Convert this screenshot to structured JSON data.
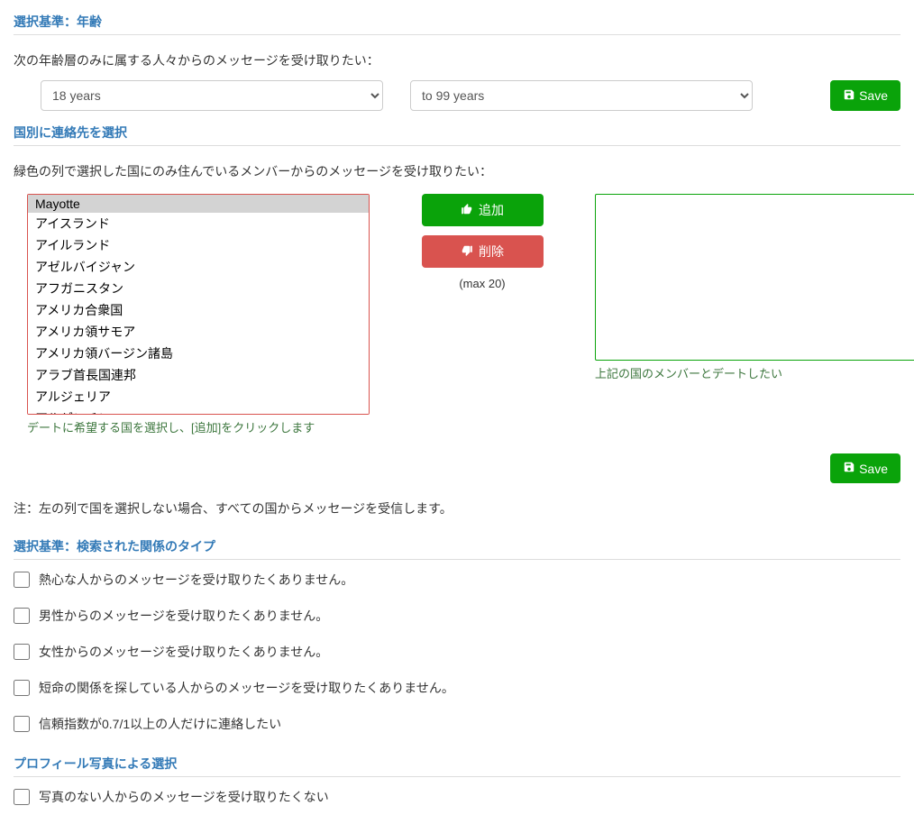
{
  "age": {
    "title": "選択基準：年齢",
    "desc": "次の年齢層のみに属する人々からのメッセージを受け取りたい：",
    "from": "18 years",
    "to": "to 99 years",
    "save": "Save"
  },
  "country": {
    "title": "国別に連絡先を選択",
    "desc": "緑色の列で選択した国にのみ住んでいるメンバーからのメッセージを受け取りたい：",
    "list": [
      "Mayotte",
      "アイスランド",
      "アイルランド",
      "アゼルバイジャン",
      "アフガニスタン",
      "アメリカ合衆国",
      "アメリカ領サモア",
      "アメリカ領バージン諸島",
      "アラブ首長国連邦",
      "アルジェリア",
      "アルゼンチン"
    ],
    "left_helper": "デートに希望する国を選択し、[追加]をクリックします",
    "right_helper": "上記の国のメンバーとデートしたい",
    "add": "追加",
    "remove": "削除",
    "max": "(max 20)",
    "save": "Save",
    "note": "注：左の列で国を選択しない場合、すべての国からメッセージを受信します。"
  },
  "relation": {
    "title": "選択基準：検索された関係のタイプ",
    "opts": [
      "熱心な人からのメッセージを受け取りたくありません。",
      "男性からのメッセージを受け取りたくありません。",
      "女性からのメッセージを受け取りたくありません。",
      "短命の関係を探している人からのメッセージを受け取りたくありません。",
      "信頼指数が0.7/1以上の人だけに連絡したい"
    ]
  },
  "photo": {
    "title": "プロフィール写真による選択",
    "opt": "写真のない人からのメッセージを受け取りたくない"
  }
}
